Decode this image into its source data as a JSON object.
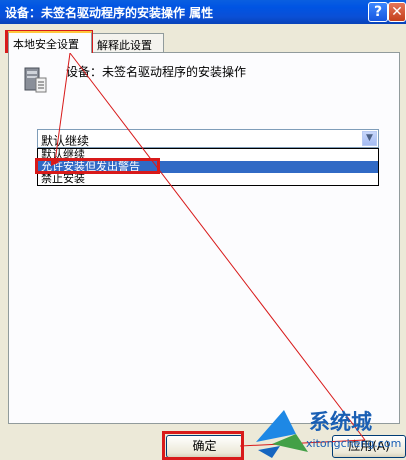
{
  "window": {
    "title": "设备：未签名驱动程序的安装操作  属性",
    "help_glyph": "?",
    "close_glyph": "✕"
  },
  "tabs": [
    {
      "label": "本地安全设置",
      "active": true
    },
    {
      "label": "解释此设置",
      "active": false
    }
  ],
  "panel": {
    "device_label": "设备：未签名驱动程序的安装操作",
    "select": {
      "value": "默认继续",
      "options": [
        "默认继续",
        "允许安装但发出警告",
        "禁止安装"
      ],
      "highlighted_option": "允许安装但发出警告"
    }
  },
  "buttons": {
    "ok": "确定",
    "apply": "应用(A)"
  },
  "watermark": {
    "text": "系统城",
    "url": "xitongcheng.com"
  },
  "colors": {
    "title_bar": "#0054e3",
    "selection": "#316ac5",
    "annotation": "#d81a1a"
  }
}
